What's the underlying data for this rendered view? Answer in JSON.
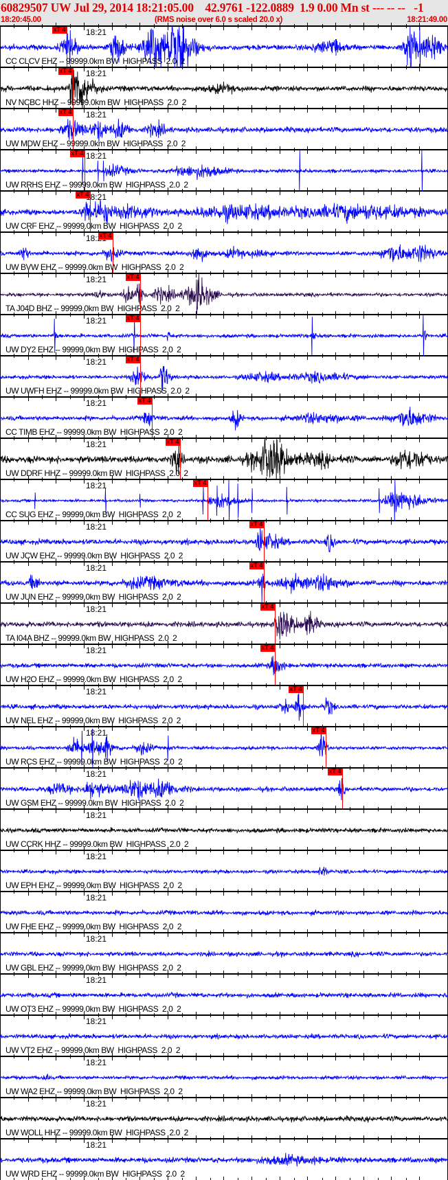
{
  "header": {
    "title": "60829507 UW Jul 29, 2014 18:21:05.00    42.9761 -122.0889  1.9 0.00 Mn st --- -- --   -1",
    "start_time": "18:20:45.00",
    "note": "(RMS noise over 6.0 s scaled 20.0 x)",
    "end_time": "18:21:49.00"
  },
  "chart_data": {
    "type": "line",
    "title": "60829507 UW Jul 29, 2014 18:21:05.00",
    "duration_s": 64,
    "tick_interval_s": 4,
    "tick_label": "18:21",
    "tick_label_index": 3,
    "colors": {
      "blue": "#0000ff",
      "black": "#000000",
      "purple": "#2a0a50",
      "pick": "#ff0000"
    },
    "stations": [
      {
        "label": "CC CLCV EHZ -- 99999.0km BW  HIGHPASS  2.0  2",
        "color": "blue",
        "pick_s": 9.5,
        "pick_label": "xT 4",
        "noise": 3,
        "bursts": [
          [
            9.5,
            14,
            1.5
          ],
          [
            16.5,
            20,
            1.2
          ],
          [
            21.5,
            30,
            2
          ],
          [
            25,
            38,
            2.5
          ],
          [
            46,
            6,
            3
          ],
          [
            58.5,
            30,
            1.5
          ],
          [
            61.5,
            20,
            1.5
          ]
        ],
        "spikes": [
          [
            10,
            25
          ],
          [
            48,
            12
          ],
          [
            60,
            30
          ]
        ]
      },
      {
        "label": "NV NCBC HHZ -- 99999.0km BW  HIGHPASS  2.0  2",
        "color": "black",
        "pick_s": 10.4,
        "pick_label": "xT 4",
        "noise": 3,
        "bursts": [
          [
            10.5,
            40,
            0.9
          ],
          [
            12,
            18,
            1.6
          ],
          [
            31,
            4,
            3
          ]
        ],
        "spikes": []
      },
      {
        "label": "UW MDW EHZ -- 99999.0km BW  HIGHPASS  2.0  2",
        "color": "blue",
        "pick_s": 10.4,
        "pick_label": "xT 4",
        "noise": 3,
        "bursts": [
          [
            10,
            10,
            2.5
          ],
          [
            14,
            10,
            1.5
          ],
          [
            17,
            10,
            1.5
          ],
          [
            22,
            8,
            1.5
          ]
        ],
        "spikes": []
      },
      {
        "label": "UW RRHS EHZ -- 99999.0km BW  HIGHPASS  2.0  2",
        "color": "blue",
        "pick_s": 12.1,
        "pick_label": "xT 4",
        "noise": 2,
        "bursts": [
          [
            16,
            6,
            2.5
          ],
          [
            26,
            5,
            3
          ],
          [
            29,
            6,
            3
          ]
        ],
        "spikes": [
          [
            11.8,
            20
          ],
          [
            14,
            15
          ],
          [
            14.8,
            15
          ],
          [
            42.8,
            30
          ],
          [
            60.3,
            30
          ]
        ]
      },
      {
        "label": "UW CRF EHZ -- 99999.0km BW  HIGHPASS  2.0  2",
        "color": "blue",
        "pick_s": 12.9,
        "pick_label": "xT 4",
        "noise": 3,
        "bursts": [
          [
            12.3,
            14,
            1
          ],
          [
            14.5,
            14,
            2
          ],
          [
            19,
            8,
            3
          ],
          [
            33,
            8,
            10
          ],
          [
            50,
            8,
            10
          ]
        ],
        "spikes": []
      },
      {
        "label": "UW BVW EHZ -- 99999.0km BW  HIGHPASS  2.0  2",
        "color": "blue",
        "pick_s": 16.1,
        "pick_label": "xT 4",
        "noise": 2.5,
        "bursts": [
          [
            3.3,
            8,
            0.8
          ],
          [
            15.5,
            10,
            1.2
          ],
          [
            28,
            10,
            1.5
          ],
          [
            33,
            6,
            1.5
          ],
          [
            36.5,
            6,
            1.5
          ],
          [
            56,
            12,
            2.5
          ],
          [
            60,
            10,
            2
          ]
        ],
        "spikes": []
      },
      {
        "label": "TA J04D BHZ -- 99999.0km BW  HIGHPASS  2.0  2",
        "color": "purple",
        "pick_s": 20.0,
        "pick_label": "xT 4",
        "noise": 2,
        "bursts": [
          [
            14,
            6,
            0.8
          ],
          [
            18,
            10,
            1
          ],
          [
            19.8,
            16,
            0.8
          ],
          [
            23,
            8,
            2.5
          ],
          [
            27,
            10,
            1.5
          ],
          [
            28.3,
            24,
            1
          ],
          [
            30,
            8,
            1.2
          ]
        ],
        "spikes": []
      },
      {
        "label": "UW DY2 EHZ -- 99999.0km BW  HIGHPASS  2.0  2",
        "color": "blue",
        "pick_s": 20.0,
        "pick_label": "xT 4",
        "noise": 2,
        "bursts": [
          [
            7.8,
            6,
            0.4
          ],
          [
            24,
            6,
            0.4
          ],
          [
            44.7,
            6,
            0.4
          ],
          [
            60.6,
            6,
            0.4
          ]
        ],
        "spikes": [
          [
            7.8,
            25
          ],
          [
            19.2,
            25
          ],
          [
            44.6,
            28
          ],
          [
            60.5,
            30
          ]
        ]
      },
      {
        "label": "UW UWFH EHZ -- 99999.0km BW  HIGHPASS  2.0  2",
        "color": "blue",
        "pick_s": 20.0,
        "pick_label": "xT 4",
        "noise": 2,
        "bursts": [
          [
            19.5,
            10,
            1.5
          ],
          [
            23.2,
            20,
            0.8
          ],
          [
            37,
            5,
            4
          ],
          [
            45,
            5,
            5
          ]
        ],
        "spikes": []
      },
      {
        "label": "CC TIMB EHZ -- 99999.0km BW  HIGHPASS  2.0  2",
        "color": "blue",
        "pick_s": 21.7,
        "pick_label": "xT 4",
        "noise": 2.5,
        "bursts": [
          [
            21,
            10,
            0.8
          ],
          [
            33.5,
            12,
            0.8
          ],
          [
            45,
            5,
            5
          ],
          [
            58,
            12,
            3
          ]
        ],
        "spikes": []
      },
      {
        "label": "UW DDRF HHZ -- 99999.0km BW  HIGHPASS  2.0  2",
        "color": "black",
        "pick_s": 25.7,
        "pick_label": "xT 4",
        "noise": 4,
        "bursts": [
          [
            25,
            17,
            0.8
          ],
          [
            37,
            8,
            4
          ],
          [
            38.5,
            22,
            2.5
          ],
          [
            45,
            6,
            3
          ],
          [
            58,
            12,
            3
          ]
        ],
        "spikes": []
      },
      {
        "label": "CC SUG EHZ -- 99999.0km BW  HIGHPASS  2.0  2",
        "color": "blue",
        "pick_s": 29.6,
        "pick_label": "xT 4",
        "noise": 1.5,
        "bursts": [
          [
            31,
            10,
            2.5
          ],
          [
            57,
            12,
            4
          ]
        ],
        "spikes": [
          [
            5,
            12
          ],
          [
            15.1,
            18
          ],
          [
            20,
            10
          ],
          [
            29,
            20
          ],
          [
            31,
            22
          ],
          [
            32.7,
            30
          ],
          [
            34,
            25
          ],
          [
            36,
            18
          ],
          [
            41,
            20
          ],
          [
            54.2,
            18
          ],
          [
            56.4,
            30
          ]
        ]
      },
      {
        "label": "UW JCW EHZ -- 99999.0km BW  HIGHPASS  2.0  2",
        "color": "blue",
        "pick_s": 37.7,
        "pick_label": "xT 4",
        "noise": 3,
        "bursts": [
          [
            37,
            20,
            0.6
          ],
          [
            38.5,
            10,
            1.5
          ],
          [
            47,
            10,
            0.8
          ]
        ],
        "spikes": []
      },
      {
        "label": "UW JUN EHZ -- 99999.0km BW  HIGHPASS  2.0  2",
        "color": "blue",
        "pick_s": 37.7,
        "pick_label": "xT 4",
        "noise": 3,
        "bursts": [
          [
            4.7,
            10,
            0.8
          ],
          [
            20,
            6,
            5
          ],
          [
            37.3,
            16,
            0.6
          ],
          [
            41,
            8,
            3
          ],
          [
            46,
            8,
            3
          ]
        ],
        "spikes": []
      },
      {
        "label": "TA I04A BHZ -- 99999.0km BW  HIGHPASS  2.0  2",
        "color": "purple",
        "pick_s": 39.3,
        "pick_label": "xT 4",
        "noise": 3,
        "bursts": [
          [
            39.8,
            24,
            0.8
          ],
          [
            41,
            10,
            1.8
          ],
          [
            44,
            14,
            1.2
          ]
        ],
        "spikes": []
      },
      {
        "label": "UW H2O EHZ -- 99999.0km BW  HIGHPASS  2.0  2",
        "color": "blue",
        "pick_s": 39.3,
        "pick_label": "xT 4",
        "noise": 2.5,
        "bursts": [
          [
            39.2,
            14,
            1
          ]
        ],
        "spikes": []
      },
      {
        "label": "UW NEL EHZ -- 99999.0km BW  HIGHPASS  2.0  2",
        "color": "blue",
        "pick_s": 43.3,
        "pick_label": "xT 4",
        "noise": 2.5,
        "bursts": [
          [
            40.5,
            8,
            0.8
          ],
          [
            42.6,
            14,
            0.8
          ],
          [
            46.8,
            10,
            0.8
          ]
        ],
        "spikes": []
      },
      {
        "label": "UW RCS EHZ -- 99999.0km BW  HIGHPASS  2.0  2",
        "color": "blue",
        "pick_s": 46.5,
        "pick_label": "xT 4",
        "noise": 2,
        "bursts": [
          [
            10.5,
            10,
            1.5
          ],
          [
            13,
            10,
            1.5
          ],
          [
            15,
            8,
            1.5
          ],
          [
            20,
            8,
            1.5
          ],
          [
            45.9,
            30,
            0.6
          ]
        ],
        "spikes": [
          [
            11.7,
            25
          ],
          [
            13.2,
            28
          ],
          [
            15.3,
            20
          ],
          [
            24,
            18
          ]
        ]
      },
      {
        "label": "UW GSM EHZ -- 99999.0km BW  HIGHPASS  2.0  2",
        "color": "blue",
        "pick_s": 48.9,
        "pick_label": "xT 4",
        "noise": 2.5,
        "bursts": [
          [
            8,
            7,
            2
          ],
          [
            13,
            10,
            2.5
          ],
          [
            19,
            12,
            2.5
          ],
          [
            23,
            10,
            2.5
          ],
          [
            48.6,
            10,
            0.6
          ]
        ],
        "spikes": [
          [
            48.8,
            16
          ]
        ]
      },
      {
        "label": "UW CCRK HHZ -- 99999.0km BW  HIGHPASS  2.0  2",
        "color": "black",
        "noise": 2.5,
        "bursts": [],
        "spikes": []
      },
      {
        "label": "UW EPH EHZ -- 99999.0km BW  HIGHPASS  2.0  2",
        "color": "blue",
        "noise": 2,
        "bursts": [
          [
            46,
            5,
            1
          ]
        ],
        "spikes": []
      },
      {
        "label": "UW FHE EHZ -- 99999.0km BW  HIGHPASS  2.0  2",
        "color": "blue",
        "noise": 2.5,
        "bursts": [],
        "spikes": []
      },
      {
        "label": "UW GBL EHZ -- 99999.0km BW  HIGHPASS  2.0  2",
        "color": "blue",
        "noise": 2.5,
        "bursts": [],
        "spikes": []
      },
      {
        "label": "UW OT3 EHZ -- 99999.0km BW  HIGHPASS  2.0  2",
        "color": "blue",
        "noise": 2.5,
        "bursts": [],
        "spikes": []
      },
      {
        "label": "UW VT2 EHZ -- 99999.0km BW  HIGHPASS  2.0  2",
        "color": "blue",
        "noise": 2.5,
        "bursts": [],
        "spikes": []
      },
      {
        "label": "UW WA2 EHZ -- 99999.0km BW  HIGHPASS  2.0  2",
        "color": "blue",
        "noise": 2,
        "bursts": [
          [
            6.5,
            5,
            0.5
          ]
        ],
        "spikes": []
      },
      {
        "label": "UW WOLL HHZ -- 99999.0km BW  HIGHPASS  2.0  2",
        "color": "black",
        "noise": 3,
        "bursts": [],
        "spikes": []
      },
      {
        "label": "UW WRD EHZ -- 99999.0km BW  HIGHPASS  2.0  2",
        "color": "blue",
        "noise": 3,
        "bursts": [
          [
            40,
            4,
            6
          ]
        ],
        "spikes": []
      }
    ]
  }
}
